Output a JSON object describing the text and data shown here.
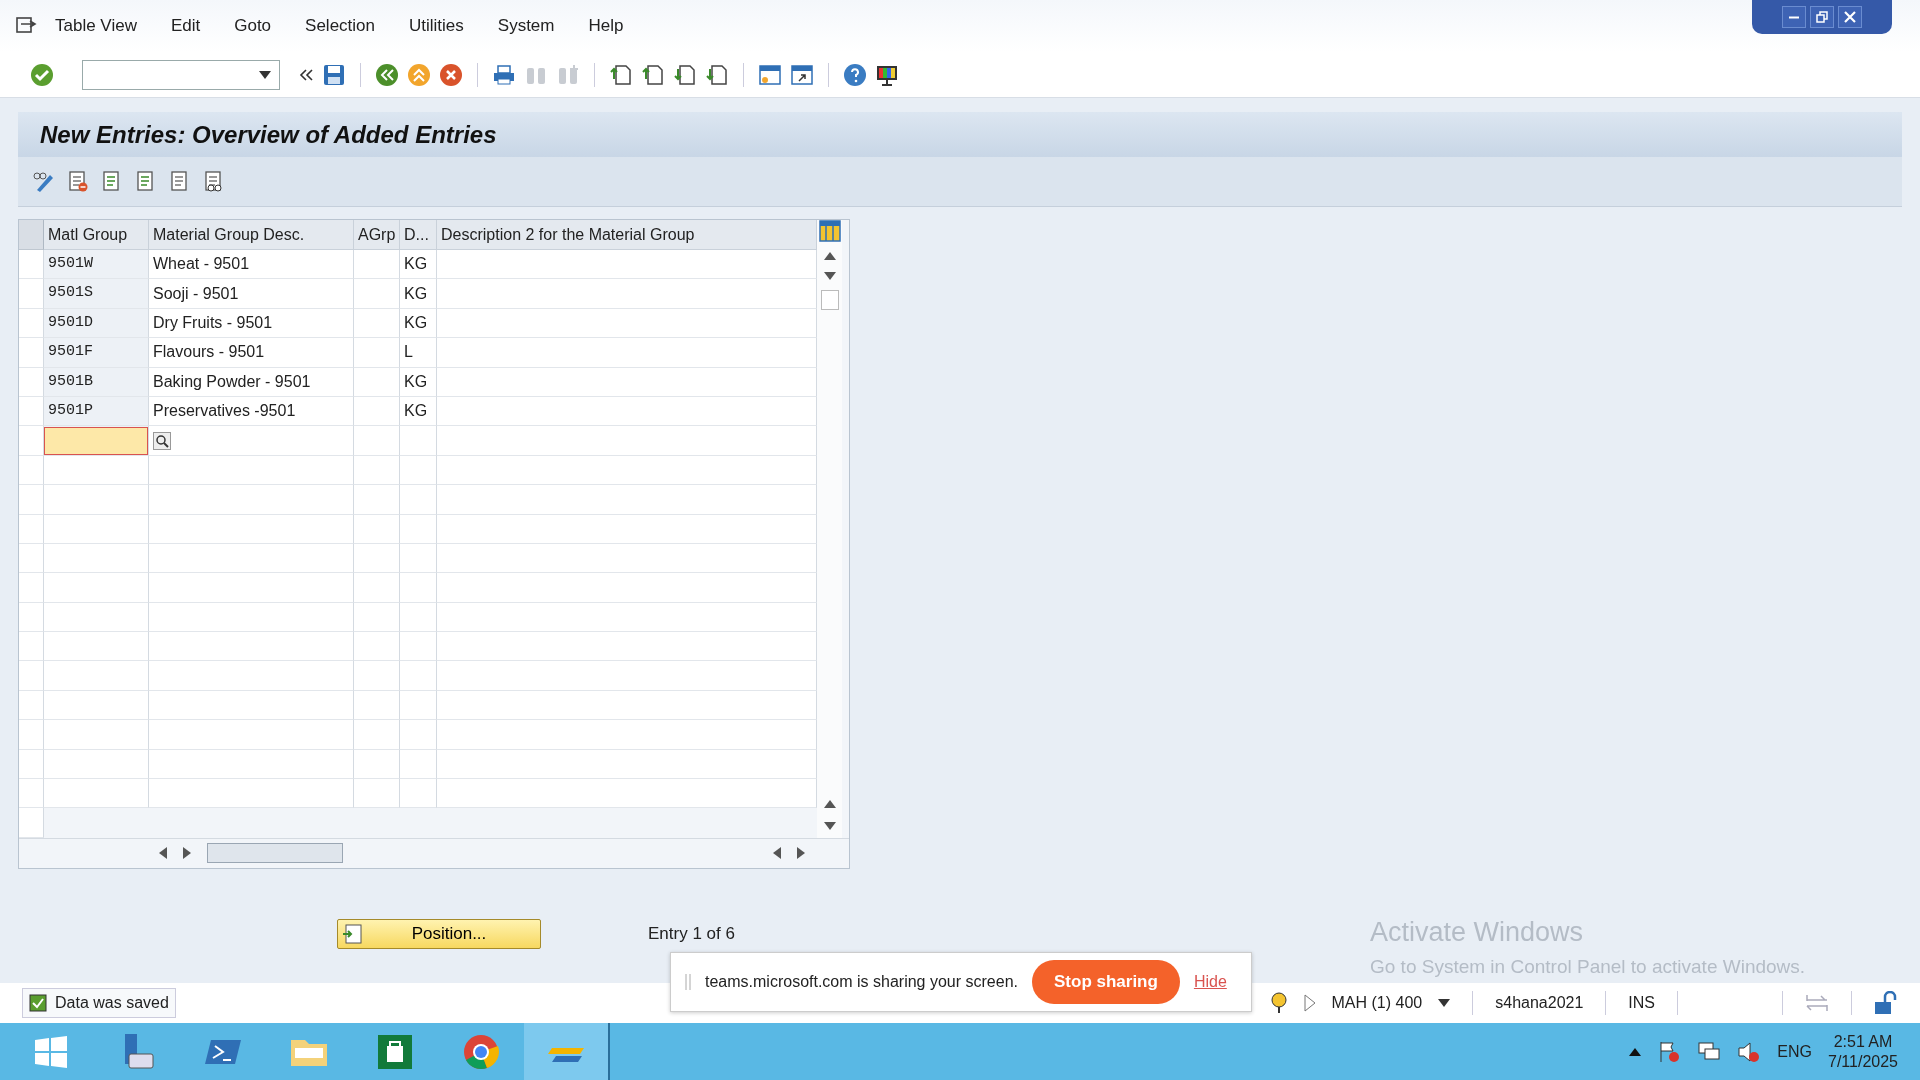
{
  "menu": [
    "Table View",
    "Edit",
    "Goto",
    "Selection",
    "Utilities",
    "System",
    "Help"
  ],
  "title": "New Entries: Overview of Added Entries",
  "table": {
    "columns": [
      "Matl Group",
      "Material Group Desc.",
      "AGrp",
      "D...",
      "Description 2 for the Material Group"
    ],
    "rows": [
      {
        "cells": [
          "9501W",
          "Wheat - 9501",
          "",
          "KG",
          ""
        ]
      },
      {
        "cells": [
          "9501S",
          "Sooji - 9501",
          "",
          "KG",
          ""
        ]
      },
      {
        "cells": [
          "9501D",
          "Dry Fruits - 9501",
          "",
          "KG",
          ""
        ]
      },
      {
        "cells": [
          "9501F",
          "Flavours - 9501",
          "",
          "L",
          ""
        ]
      },
      {
        "cells": [
          "9501B",
          "Baking Powder - 9501",
          "",
          "KG",
          ""
        ]
      },
      {
        "cells": [
          "9501P",
          "Preservatives -9501",
          "",
          "KG",
          ""
        ]
      }
    ]
  },
  "position_button": "Position...",
  "entry_info": "Entry 1 of 6",
  "status_message": "Data was saved",
  "status_bar": {
    "system": "MAH (1) 400",
    "server": "s4hana2021",
    "mode": "INS"
  },
  "sharing_banner": {
    "text": "teams.microsoft.com is sharing your screen.",
    "stop": "Stop sharing",
    "hide": "Hide"
  },
  "activation_notice": {
    "title": "Activate Windows",
    "text": "Go to System in Control Panel to activate Windows."
  },
  "taskbar": {
    "language": "ENG",
    "time": "2:51 AM",
    "date": "7/11/2025"
  }
}
